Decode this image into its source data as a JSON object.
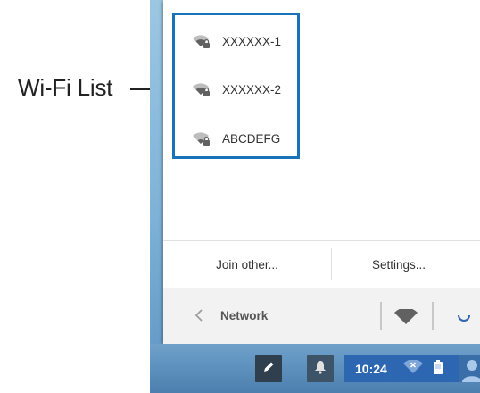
{
  "annotation": {
    "label": "Wi-Fi List"
  },
  "networks": [
    {
      "ssid": "XXXXXX-1",
      "icon": "wifi-secure-icon"
    },
    {
      "ssid": "XXXXXX-2",
      "icon": "wifi-secure-icon"
    },
    {
      "ssid": "ABCDEFG",
      "icon": "wifi-secure-icon"
    }
  ],
  "actions": {
    "join_other": "Join other...",
    "settings": "Settings..."
  },
  "footer": {
    "title": "Network"
  },
  "shelf": {
    "clock": "10:24"
  },
  "colors": {
    "highlight": "#1a73b8",
    "status_area": "#2d67b2"
  }
}
